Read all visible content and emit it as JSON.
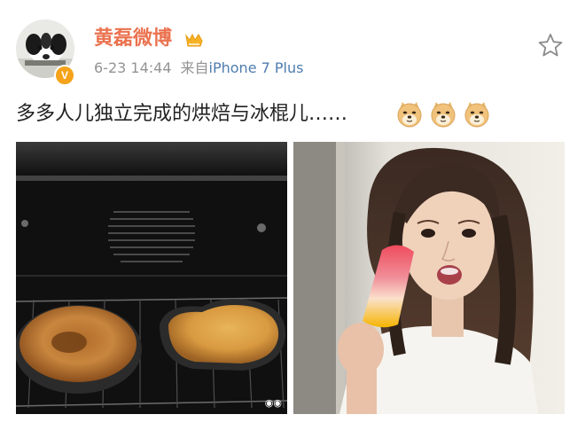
{
  "post": {
    "username": "黄磊微博",
    "date": "6-23 14:44",
    "source_prefix": "来自",
    "source": "iPhone 7 Plus",
    "text": "多多人儿独立完成的烘焙与冰棍儿……",
    "emojis": [
      "doge-icon",
      "doge-icon",
      "doge-icon"
    ]
  },
  "photos": [
    {
      "name": "oven-photo",
      "watermark": "◉◉"
    },
    {
      "name": "girl-popsicle-photo"
    }
  ],
  "colors": {
    "username": "#eb7350",
    "meta": "#939393",
    "link": "#507daf",
    "verified": "#f5a31a"
  }
}
